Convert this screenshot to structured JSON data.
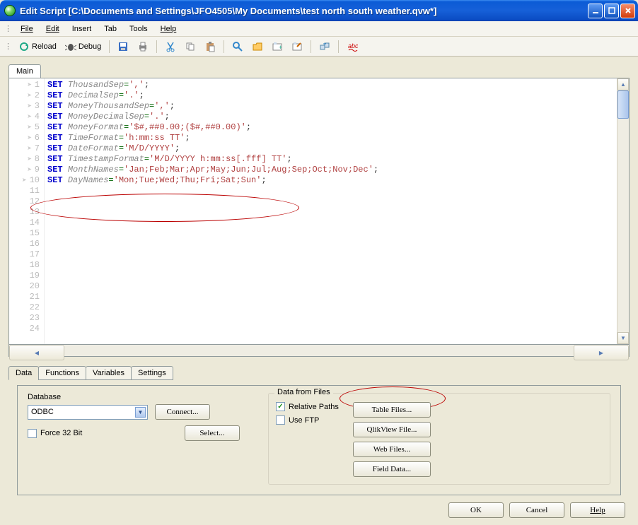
{
  "window": {
    "title": "Edit Script [C:\\Documents and Settings\\JFO4505\\My Documents\\test north south weather.qvw*]"
  },
  "menu": {
    "file": "File",
    "edit": "Edit",
    "insert": "Insert",
    "tab": "Tab",
    "tools": "Tools",
    "help": "Help"
  },
  "toolbar": {
    "reload": "Reload",
    "debug": "Debug"
  },
  "tabs": {
    "main": "Main"
  },
  "script": {
    "lines": [
      {
        "kw": "SET",
        "var": "ThousandSep",
        "op": "=",
        "str": "','",
        "end": ";"
      },
      {
        "kw": "SET",
        "var": "DecimalSep",
        "op": "=",
        "str": "'.'",
        "end": ";"
      },
      {
        "kw": "SET",
        "var": "MoneyThousandSep",
        "op": "=",
        "str": "','",
        "end": ";"
      },
      {
        "kw": "SET",
        "var": "MoneyDecimalSep",
        "op": "=",
        "str": "'.'",
        "end": ";"
      },
      {
        "kw": "SET",
        "var": "MoneyFormat",
        "op": "=",
        "str": "'$#,##0.00;($#,##0.00)'",
        "end": ";"
      },
      {
        "kw": "SET",
        "var": "TimeFormat",
        "op": "=",
        "str": "'h:mm:ss TT'",
        "end": ";"
      },
      {
        "kw": "SET",
        "var": "DateFormat",
        "op": "=",
        "str": "'M/D/YYYY'",
        "end": ";"
      },
      {
        "kw": "SET",
        "var": "TimestampFormat",
        "op": "=",
        "str": "'M/D/YYYY h:mm:ss[.fff] TT'",
        "end": ";"
      },
      {
        "kw": "SET",
        "var": "MonthNames",
        "op": "=",
        "str": "'Jan;Feb;Mar;Apr;May;Jun;Jul;Aug;Sep;Oct;Nov;Dec'",
        "end": ";"
      },
      {
        "kw": "SET",
        "var": "DayNames",
        "op": "=",
        "str": "'Mon;Tue;Wed;Thu;Fri;Sat;Sun'",
        "end": ";"
      }
    ]
  },
  "bottomTabs": {
    "data": "Data",
    "functions": "Functions",
    "variables": "Variables",
    "settings": "Settings"
  },
  "database": {
    "legend": "Database",
    "selected": "ODBC",
    "connect": "Connect...",
    "select": "Select...",
    "force32": "Force 32 Bit"
  },
  "files": {
    "legend": "Data from Files",
    "relativePaths": "Relative Paths",
    "useFtp": "Use FTP",
    "tableFiles": "Table Files...",
    "qlikviewFile": "QlikView File...",
    "webFiles": "Web Files...",
    "fieldData": "Field Data..."
  },
  "dialog": {
    "ok": "OK",
    "cancel": "Cancel",
    "help": "Help"
  }
}
